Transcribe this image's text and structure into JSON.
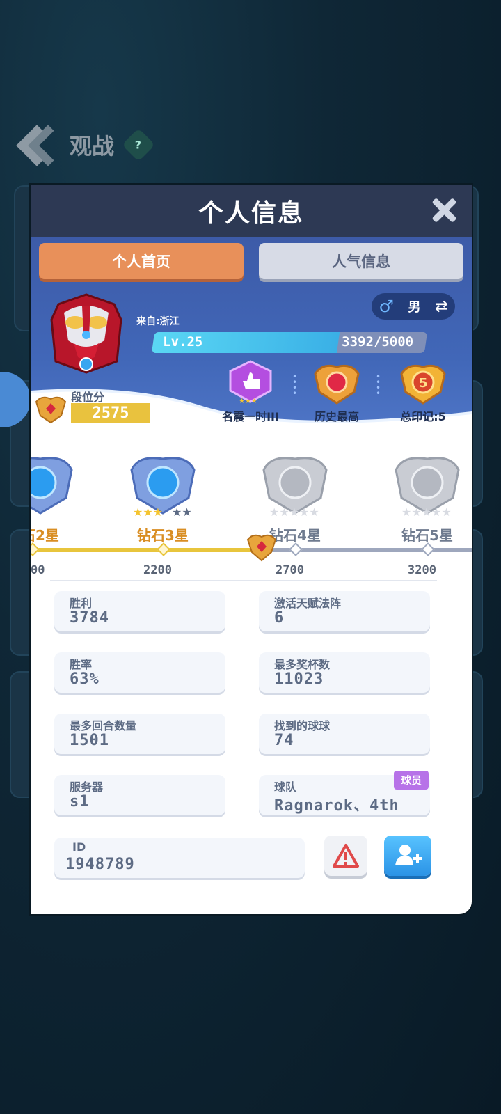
{
  "background": {
    "title": "观战",
    "help_label": "?"
  },
  "modal": {
    "title": "个人信息",
    "tabs": [
      {
        "label": "个人首页",
        "active": true
      },
      {
        "label": "人气信息",
        "active": false
      }
    ],
    "profile": {
      "from": "来自:浙江",
      "gender": "男",
      "level_text": "Lv.25",
      "xp_text": "3392/5000",
      "xp_fraction": 0.6784,
      "rank_score_label": "段位分",
      "rank_score": "2575"
    },
    "achievements": [
      {
        "label": "名震一时III",
        "icon": "thumbs-up-badge-icon"
      },
      {
        "label": "历史最高",
        "icon": "ruby-medal-icon"
      },
      {
        "label": "总印记:5",
        "icon": "gold-medal-5-icon",
        "number": "5"
      }
    ],
    "tiers": [
      {
        "label": "石2星",
        "color": "gold"
      },
      {
        "label": "钻石3星",
        "color": "gold"
      },
      {
        "label": "钻石4星",
        "color": "gray"
      },
      {
        "label": "钻石5星",
        "color": "gray"
      }
    ],
    "progress_ticks": [
      "00",
      "2200",
      "2700",
      "3200"
    ],
    "stats": [
      {
        "label": "胜利",
        "value": "3784"
      },
      {
        "label": "激活天赋法阵",
        "value": "6"
      },
      {
        "label": "胜率",
        "value": "63%"
      },
      {
        "label": "最多奖杯数",
        "value": "11023"
      },
      {
        "label": "最多回合数量",
        "value": "1501"
      },
      {
        "label": "找到的球球",
        "value": "74"
      },
      {
        "label": "服务器",
        "value": "s1"
      },
      {
        "label": "球队",
        "value": "Ragnarok、4th",
        "badge": "球员"
      }
    ],
    "id_label": "ID",
    "id_value": "1948789"
  },
  "colors": {
    "header": "#2d3954",
    "tab_active": "#e8905a",
    "gold": "#e8c53c",
    "profile_blue": "#4167b8"
  }
}
